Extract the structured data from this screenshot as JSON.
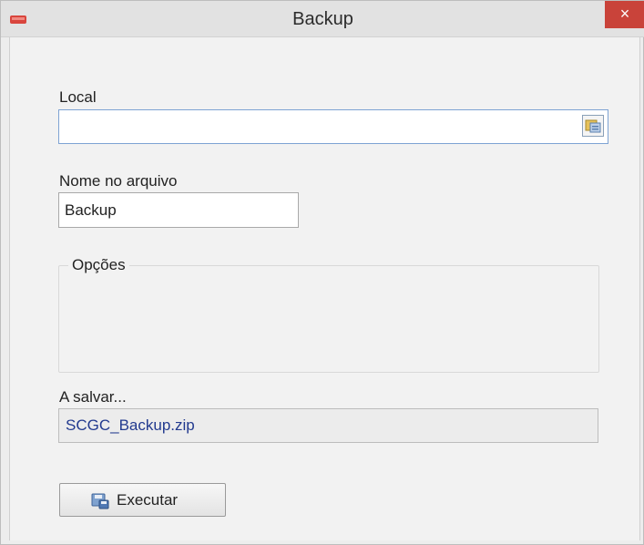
{
  "window": {
    "title": "Backup",
    "close_glyph": "×",
    "app_icon": "red-app-icon",
    "accent_close": "#c9433a"
  },
  "local": {
    "label": "Local",
    "value": "",
    "browse_icon": "folder-browse-icon"
  },
  "filename": {
    "label": "Nome no arquivo",
    "value": "Backup"
  },
  "options": {
    "label": "Opções"
  },
  "output": {
    "label": "A salvar...",
    "value": "SCGC_Backup.zip"
  },
  "execute": {
    "label": "Executar",
    "icon": "save-disk-icon"
  }
}
